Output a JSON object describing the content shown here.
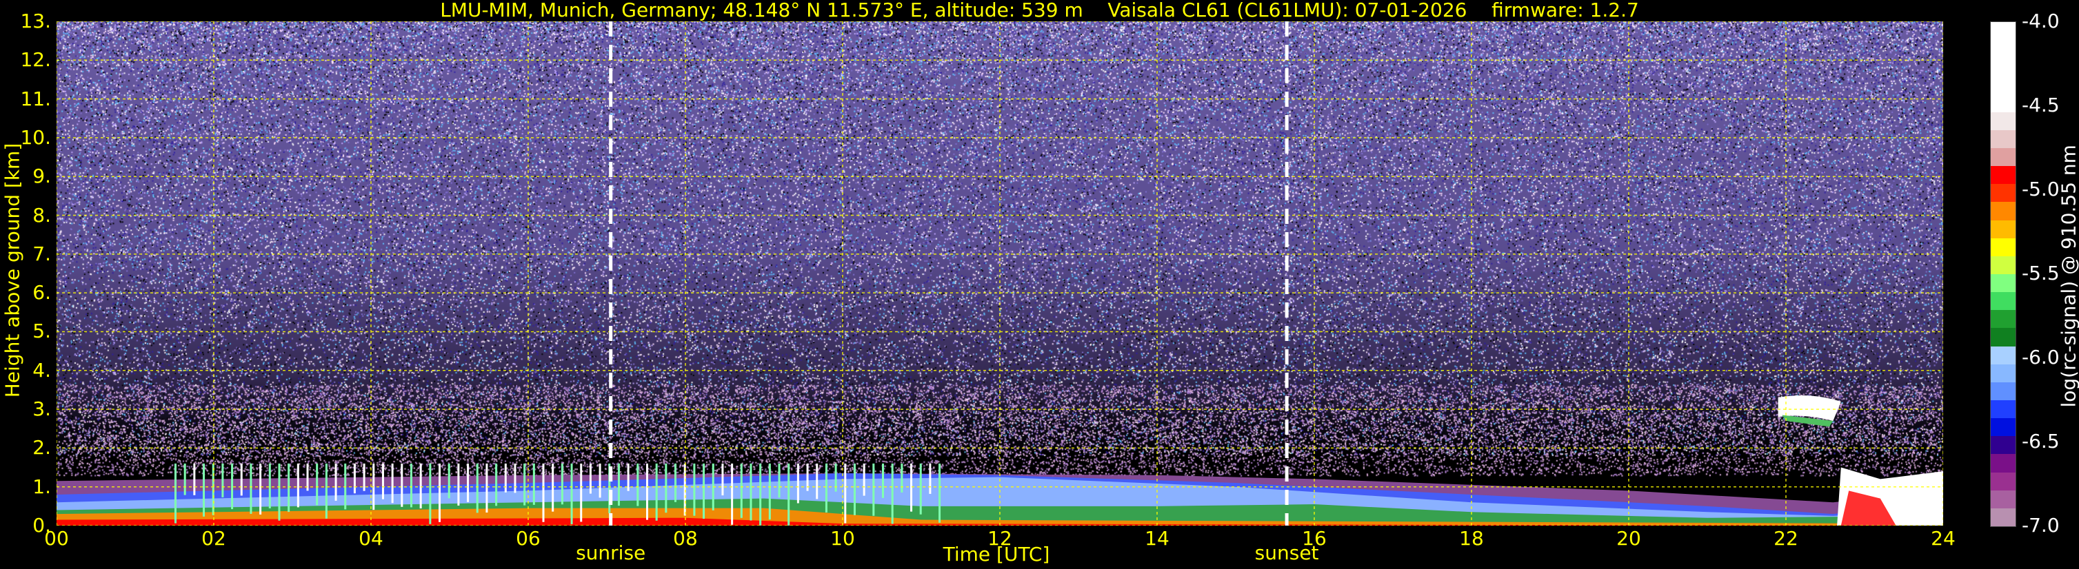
{
  "title": "LMU-MIM, Munich, Germany; 48.148° N 11.573° E, altitude: 539 m    Vaisala CL61 (CL61LMU): 07-01-2026    firmware: 1.2.7",
  "colors": {
    "text": "#ffff00",
    "grid": "#ffff00",
    "background": "#000000",
    "event_lines": "#ffffff"
  },
  "chart_data": {
    "type": "heatmap",
    "title": "LMU-MIM, Munich, Germany; 48.148° N 11.573° E, altitude: 539 m    Vaisala CL61 (CL61LMU): 07-01-2026    firmware: 1.2.7",
    "xlabel": "Time [UTC]",
    "ylabel": "Height above ground [km]",
    "xlim": [
      0,
      24
    ],
    "ylim": [
      0,
      13
    ],
    "x_ticks": [
      "00",
      "02",
      "04",
      "06",
      "08",
      "10",
      "12",
      "14",
      "16",
      "18",
      "20",
      "22",
      "24"
    ],
    "y_ticks": [
      "0.",
      "1.",
      "2.",
      "3.",
      "4.",
      "5.",
      "6.",
      "7.",
      "8.",
      "9.",
      "10.",
      "11.",
      "12.",
      "13."
    ],
    "grid": true,
    "events": [
      {
        "label": "sunrise",
        "x": 7.05
      },
      {
        "label": "sunset",
        "x": 15.65
      }
    ],
    "colorbar": {
      "label": "log(rc-signal) @ 910.55 nm",
      "range": [
        -7.0,
        -4.0
      ],
      "ticks": [
        "-4.0",
        "-4.5",
        "-5.0",
        "-5.5",
        "-6.0",
        "-6.5",
        "-7.0"
      ],
      "colors": [
        "#ffffff",
        "#ffffff",
        "#ffffff",
        "#ffffff",
        "#ffffff",
        "#f2e8e8",
        "#e8c8c8",
        "#e0a0a0",
        "#ff0000",
        "#ff3300",
        "#ff8800",
        "#ffbb00",
        "#ffff00",
        "#d0ff40",
        "#80ff80",
        "#40dd60",
        "#20a030",
        "#108020",
        "#a8d0ff",
        "#88b8ff",
        "#6090ff",
        "#2040ff",
        "#0010e0",
        "#300090",
        "#7a1088",
        "#9a3090",
        "#a860a0",
        "#b890b0"
      ]
    },
    "features": [
      {
        "name": "boundary layer aerosol",
        "x_range": [
          0,
          24
        ],
        "height_km": [
          0,
          1.3
        ]
      },
      {
        "name": "low cloud / noisy layer",
        "x_range": [
          1.5,
          11.5
        ],
        "height_km": [
          0.5,
          1.6
        ]
      },
      {
        "name": "cloud",
        "x_range": [
          21.9,
          22.7
        ],
        "height_km": [
          2.6,
          3.3
        ]
      },
      {
        "name": "cloud",
        "x_range": [
          22.6,
          24
        ],
        "height_km": [
          0,
          1.5
        ]
      }
    ]
  }
}
